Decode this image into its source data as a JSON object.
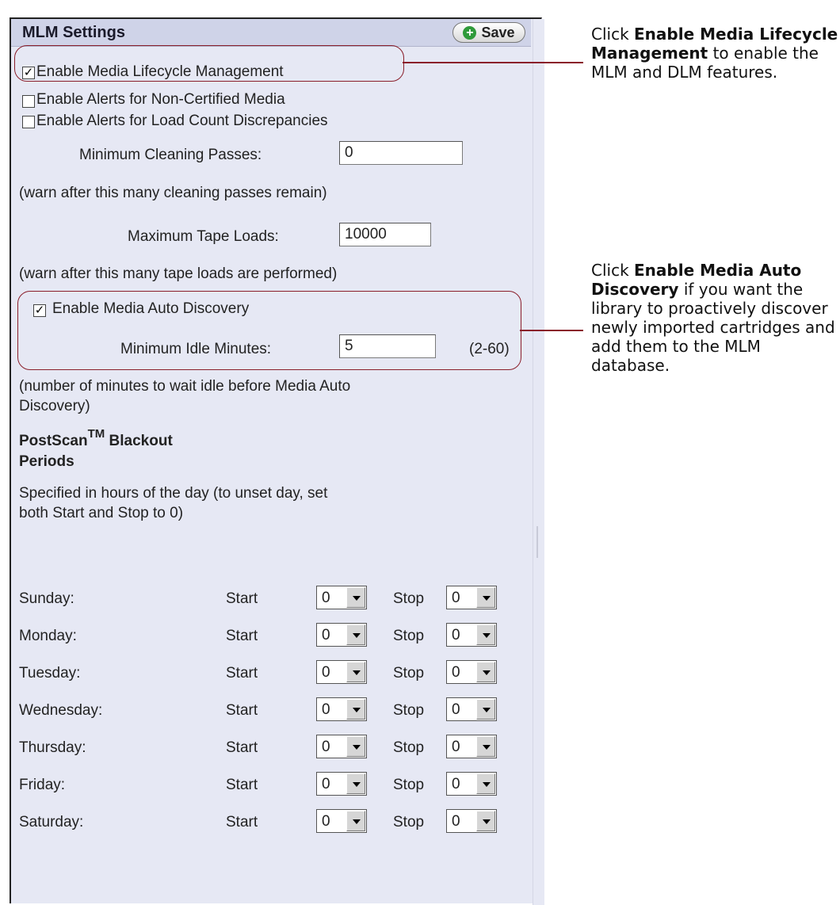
{
  "panel": {
    "title": "MLM Settings",
    "save_label": "Save",
    "enable_mlm": {
      "label": "Enable Media Lifecycle Management",
      "checked": true
    },
    "alerts_noncertified": {
      "label": "Enable Alerts for Non-Certified Media",
      "checked": false
    },
    "alerts_load_count": {
      "label": "Enable Alerts for Load Count Discrepancies",
      "checked": false
    },
    "min_cleaning": {
      "label": "Minimum Cleaning Passes:",
      "value": "0",
      "help": "(warn after this many cleaning passes remain)"
    },
    "max_loads": {
      "label": "Maximum Tape Loads:",
      "value": "10000",
      "help": "(warn after this many tape loads are performed)"
    },
    "auto_discovery": {
      "label": "Enable Media Auto Discovery",
      "checked": true
    },
    "idle_minutes": {
      "label": "Minimum Idle Minutes:",
      "value": "5",
      "range": "(2-60)"
    },
    "idle_help_line1": "(number of minutes to wait idle before Media Auto",
    "idle_help_line2": "Discovery)",
    "blackout_title_a": "PostScan",
    "blackout_title_tm": "TM",
    "blackout_title_b": " Blackout",
    "blackout_title_line2": "Periods",
    "blackout_help_line1": "Specified in hours of the day (to unset day, set",
    "blackout_help_line2": "both Start and Stop to 0)",
    "start_label": "Start",
    "stop_label": "Stop",
    "days": [
      {
        "name": "Sunday:",
        "start": "0",
        "stop": "0"
      },
      {
        "name": "Monday:",
        "start": "0",
        "stop": "0"
      },
      {
        "name": "Tuesday:",
        "start": "0",
        "stop": "0"
      },
      {
        "name": "Wednesday:",
        "start": "0",
        "stop": "0"
      },
      {
        "name": "Thursday:",
        "start": "0",
        "stop": "0"
      },
      {
        "name": "Friday:",
        "start": "0",
        "stop": "0"
      },
      {
        "name": "Saturday:",
        "start": "0",
        "stop": "0"
      }
    ]
  },
  "annotations": {
    "mlm": {
      "prefix": "Click ",
      "bold": "Enable Media Lifecycle Management",
      "suffix": " to enable the MLM and DLM features."
    },
    "discovery": {
      "prefix": "Click ",
      "bold": "Enable Media Auto Discovery",
      "suffix": " if you want the library to proactively discover newly imported cartridges and add them to the MLM database."
    }
  },
  "colors": {
    "panel_bg": "#e6e8f4",
    "header_bg": "#cfd3e8",
    "callout": "#8a1e2a",
    "plus_icon": "#2f9a3a"
  },
  "icons": {
    "save": "plus-circle-icon",
    "checkbox_checked": "check-icon",
    "dropdown": "chevron-down-icon"
  }
}
